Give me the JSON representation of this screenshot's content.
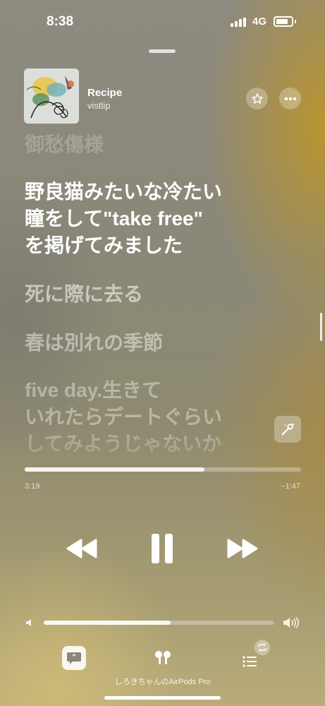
{
  "status_bar": {
    "time": "8:38",
    "network": "4G"
  },
  "now_playing": {
    "title": "Recipe",
    "artist": "vistlip",
    "artwork_icon": "album-art"
  },
  "lyrics": {
    "lines": [
      "御愁傷様",
      "野良猫みたいな冷たい\n瞳をして\"take free\"\nを掲げてみました",
      "死に際に去る",
      "春は別れの季節",
      "five day.生きて\nいれたらデートぐらい\nしてみようじゃないか"
    ]
  },
  "playback": {
    "elapsed": "3:19",
    "remaining": "−1:47",
    "progress_fraction": 0.65,
    "volume_fraction": 0.55
  },
  "bottom": {
    "device_name": "しろきちゃんのAirPods Pro"
  },
  "icons": {
    "star": "star-icon",
    "more": "more-icon",
    "lyrics_mic": "sing-icon",
    "rewind": "rewind-icon",
    "pause": "pause-icon",
    "forward": "fast-forward-icon",
    "vol_low": "volume-low-icon",
    "vol_high": "volume-high-icon",
    "lyrics": "lyrics-icon",
    "airplay": "airpods-icon",
    "queue": "queue-icon"
  }
}
